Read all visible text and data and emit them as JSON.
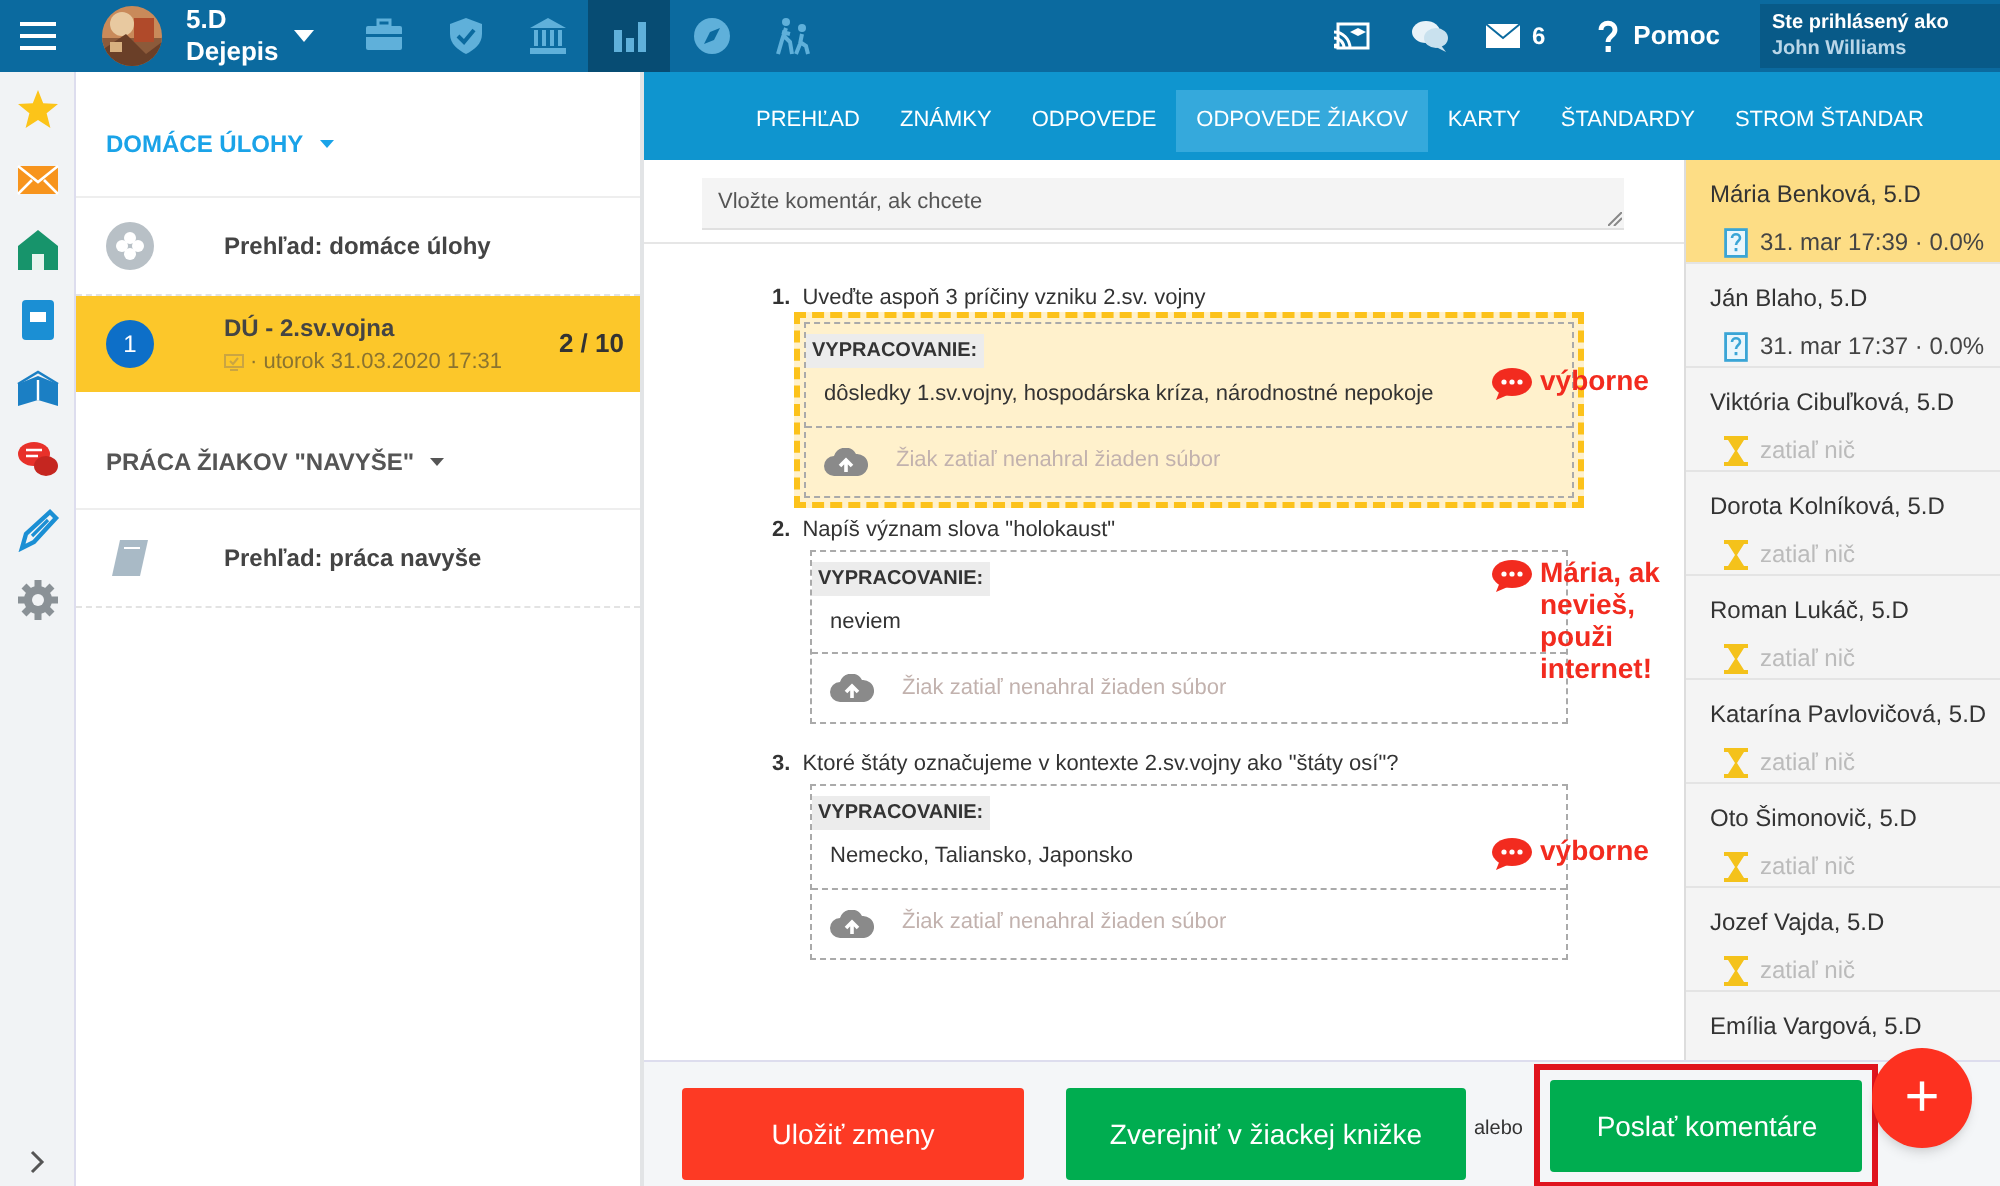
{
  "topbar": {
    "class_code": "5.D",
    "subject": "Dejepis",
    "nav_icons": [
      {
        "kind": "briefcase",
        "selected": false
      },
      {
        "kind": "shield",
        "selected": false
      },
      {
        "kind": "bank",
        "selected": false
      },
      {
        "kind": "chart",
        "selected": true
      },
      {
        "kind": "compass",
        "selected": false
      },
      {
        "kind": "walkers",
        "selected": false
      }
    ],
    "messages_count": "6",
    "help": "Pomoc",
    "login_label": "Ste prihlásený ako",
    "user": "John Williams"
  },
  "sections": [
    {
      "title": "DOMÁCE ÚLOHY",
      "active": true,
      "items": [
        {
          "kind": "overview",
          "title": "Prehľad: domáce úlohy",
          "selected": false
        },
        {
          "kind": "assignment",
          "badge": "1",
          "title": "DÚ - 2.sv.vojna",
          "date": "· utorok 31.03.2020 17:31",
          "count": "2 / 10",
          "selected": true
        }
      ]
    },
    {
      "title": "PRÁCA ŽIAKOV \"NAVYŠE\"",
      "active": false,
      "items": [
        {
          "kind": "book",
          "title": "Prehľad: práca navyše",
          "selected": false
        }
      ]
    }
  ],
  "tabs": [
    {
      "label": "PREHĽAD",
      "selected": false
    },
    {
      "label": "ZNÁMKY",
      "selected": false
    },
    {
      "label": "ODPOVEDE",
      "selected": false
    },
    {
      "label": "ODPOVEDE ŽIAKOV",
      "selected": true
    },
    {
      "label": "KARTY",
      "selected": false
    },
    {
      "label": "ŠTANDARDY",
      "selected": false
    },
    {
      "label": "STROM ŠTANDAR",
      "selected": false
    }
  ],
  "comment_field": {
    "placeholder": "Vložte komentár, ak chcete"
  },
  "questions": [
    {
      "number": "1.",
      "text": "Uveďte aspoň 3 príčiny vzniku 2.sv. vojny",
      "answer_label": "VYPRACOVANIE:",
      "answer": "dôsledky 1.sv.vojny, hospodárska kríza, národnostné nepokoje",
      "upload_text": "Žiak zatiaľ nenahral žiaden súbor",
      "highlighted": true,
      "comment": "výborne"
    },
    {
      "number": "2.",
      "text": "Napíš význam slova \"holokaust\"",
      "answer_label": "VYPRACOVANIE:",
      "answer": "neviem",
      "upload_text": "Žiak zatiaľ nenahral žiaden súbor",
      "highlighted": false,
      "comment": "Mária, ak nevieš, použi internet!"
    },
    {
      "number": "3.",
      "text": "Ktoré štáty označujeme v kontexte 2.sv.vojny ako \"štáty osí\"?",
      "answer_label": "VYPRACOVANIE:",
      "answer": "Nemecko, Taliansko, Japonsko",
      "upload_text": "Žiak zatiaľ nenahral žiaden súbor",
      "highlighted": false,
      "comment": "výborne"
    }
  ],
  "students": [
    {
      "name": "Mária Benková, 5.D",
      "kind": "submitted",
      "detail": "31. mar 17:39 · 0.0%",
      "selected": true
    },
    {
      "name": "Ján Blaho, 5.D",
      "kind": "submitted",
      "detail": "31. mar 17:37 · 0.0%",
      "selected": false
    },
    {
      "name": "Viktória Cibuľková, 5.D",
      "kind": "pending",
      "detail": "zatiaľ nič",
      "selected": false
    },
    {
      "name": "Dorota Kolníková, 5.D",
      "kind": "pending",
      "detail": "zatiaľ nič",
      "selected": false
    },
    {
      "name": "Roman Lukáč, 5.D",
      "kind": "pending",
      "detail": "zatiaľ nič",
      "selected": false
    },
    {
      "name": "Katarína Pavlovičová, 5.D",
      "kind": "pending",
      "detail": "zatiaľ nič",
      "selected": false
    },
    {
      "name": "Oto Šimonovič, 5.D",
      "kind": "pending",
      "detail": "zatiaľ nič",
      "selected": false
    },
    {
      "name": "Jozef Vajda, 5.D",
      "kind": "pending",
      "detail": "zatiaľ nič",
      "selected": false
    },
    {
      "name": "Emília Vargová, 5.D",
      "kind": "pending",
      "selected": false
    }
  ],
  "footer": {
    "save": "Uložiť zmeny",
    "publish": "Zverejniť v žiackej knižke",
    "or": "alebo",
    "send": "Poslať komentáre",
    "send_highlighted": true,
    "fab": "+"
  }
}
